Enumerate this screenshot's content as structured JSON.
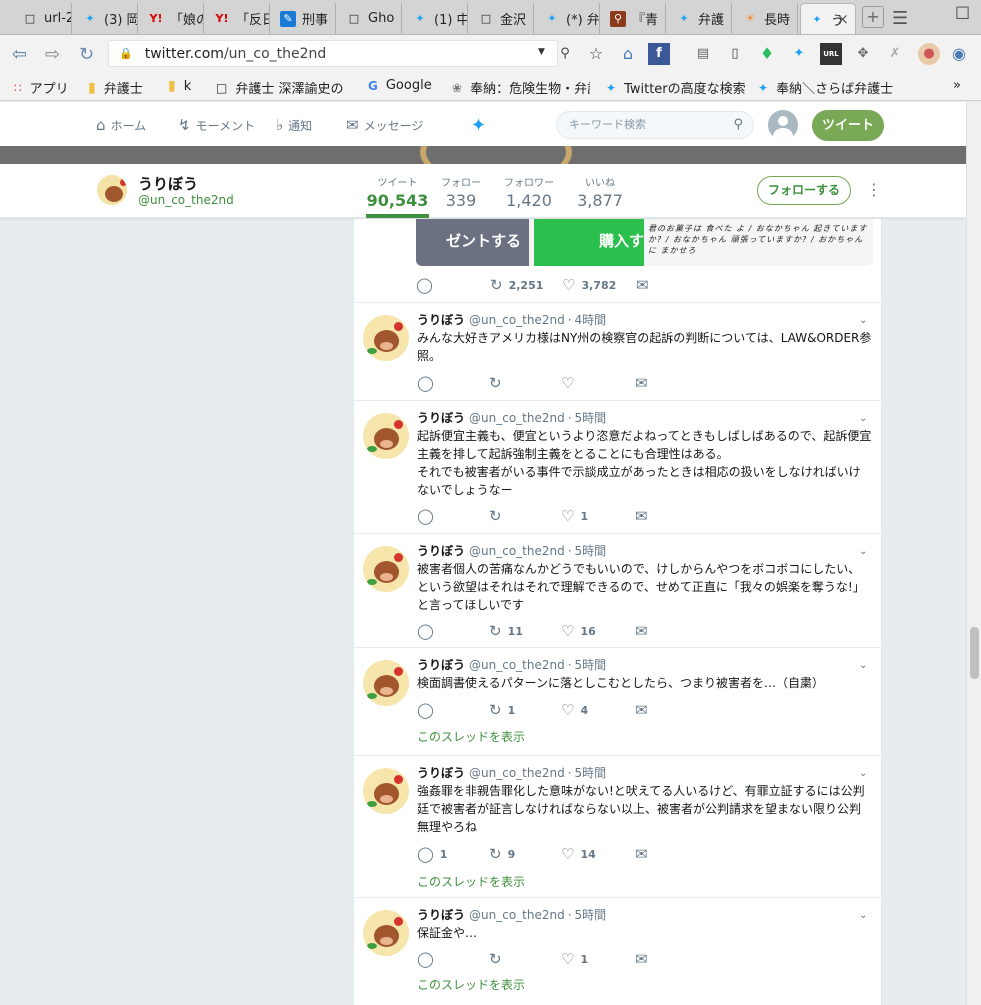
{
  "browser": {
    "tabs": [
      {
        "title": "url-2",
        "icon": "document-icon"
      },
      {
        "title": "(3) 岡",
        "icon": "twitter-icon"
      },
      {
        "title": "「娘の",
        "icon": "yahoo-icon"
      },
      {
        "title": "「反日",
        "icon": "yahoo-icon"
      },
      {
        "title": "刑事",
        "icon": "pen-icon"
      },
      {
        "title": "Gho",
        "icon": "document-icon"
      },
      {
        "title": "(1) 中",
        "icon": "twitter-icon"
      },
      {
        "title": "金沢",
        "icon": "document-icon"
      },
      {
        "title": "(*) 弁",
        "icon": "twitter-icon"
      },
      {
        "title": "『青",
        "icon": "search-icon"
      },
      {
        "title": "弁護",
        "icon": "twitter-icon"
      },
      {
        "title": "長時",
        "icon": "sun-icon"
      },
      {
        "title": "う",
        "icon": "twitter-icon",
        "active": true
      }
    ],
    "url_host": "twitter.com",
    "url_path": "/un_co_the2nd",
    "bookmarks": [
      {
        "label": "アプリ",
        "icon": "apps-grid-icon"
      },
      {
        "label": "弁護士",
        "icon": "folder-icon"
      },
      {
        "label": "k",
        "icon": "folder-icon"
      },
      {
        "label": "弁護士 深澤諭史の",
        "icon": "document-icon"
      },
      {
        "label": "Google",
        "icon": "google-icon"
      },
      {
        "label": "奉納：危険生物・弁護",
        "icon": "plant-icon"
      },
      {
        "label": "Twitterの高度な検索",
        "icon": "twitter-icon"
      },
      {
        "label": "奉納＼さらば弁護士",
        "icon": "twitter-icon"
      }
    ],
    "bookmarks_overflow": "»"
  },
  "twitter_nav": {
    "home": "ホーム",
    "moments": "モーメント",
    "notifications": "通知",
    "messages": "メッセージ",
    "search_placeholder": "キーワード検索",
    "tweet_button": "ツイート"
  },
  "profile": {
    "name": "うりぼう",
    "handle": "@un_co_the2nd",
    "stats": [
      {
        "label": "ツイート",
        "value": "90,543",
        "active": true
      },
      {
        "label": "フォロー",
        "value": "339"
      },
      {
        "label": "フォロワー",
        "value": "1,420"
      },
      {
        "label": "いいね",
        "value": "3,877"
      }
    ],
    "follow_button": "フォローする"
  },
  "top_media": {
    "gift_label": "ゼントする",
    "buy_label": "購入す",
    "handwriting": "君のお菓子は 食べた よ / おなかちゃん 起きていますか? / おなかちゃん 頑張っていますか? / おかちゃんに まかせろ",
    "retweets": "2,251",
    "likes": "3,782"
  },
  "tweets": [
    {
      "name": "うりぼう",
      "handle": "@un_co_the2nd",
      "dot": "·",
      "time": "4時間",
      "text": "みんな大好きアメリカ様はNY州の検察官の起訴の判断については、LAW&ORDER参照。",
      "replies": "",
      "retweets": "",
      "likes": "",
      "thread": ""
    },
    {
      "name": "うりぼう",
      "handle": "@un_co_the2nd",
      "dot": "·",
      "time": "5時間",
      "text": "起訴便宜主義も、便宜というより恣意だよねってときもしばしばあるので、起訴便宜主義を排して起訴強制主義をとることにも合理性はある。\nそれでも被害者がいる事件で示談成立があったときは相応の扱いをしなければいけないでしょうなー",
      "replies": "",
      "retweets": "",
      "likes": "1",
      "thread": ""
    },
    {
      "name": "うりぼう",
      "handle": "@un_co_the2nd",
      "dot": "·",
      "time": "5時間",
      "text": "被害者個人の苦痛なんかどうでもいいので、けしからんやつをボコボコにしたい、という欲望はそれはそれで理解できるので、せめて正直に「我々の娯楽を奪うな!」と言ってほしいです",
      "replies": "",
      "retweets": "11",
      "likes": "16",
      "thread": ""
    },
    {
      "name": "うりぼう",
      "handle": "@un_co_the2nd",
      "dot": "·",
      "time": "5時間",
      "text": "検面調書使えるパターンに落としこむとしたら、つまり被害者を…（自粛）",
      "replies": "",
      "retweets": "1",
      "likes": "4",
      "thread": "このスレッドを表示"
    },
    {
      "name": "うりぼう",
      "handle": "@un_co_the2nd",
      "dot": "·",
      "time": "5時間",
      "text": "強姦罪を非親告罪化した意味がない!と吠えてる人いるけど、有罪立証するには公判廷で被害者が証言しなければならない以上、被害者が公判請求を望まない限り公判無理やろね",
      "replies": "1",
      "retweets": "9",
      "likes": "14",
      "thread": "このスレッドを表示"
    },
    {
      "name": "うりぼう",
      "handle": "@un_co_the2nd",
      "dot": "·",
      "time": "5時間",
      "text": "保証金や…",
      "replies": "",
      "retweets": "",
      "likes": "1",
      "thread": "このスレッドを表示"
    }
  ]
}
